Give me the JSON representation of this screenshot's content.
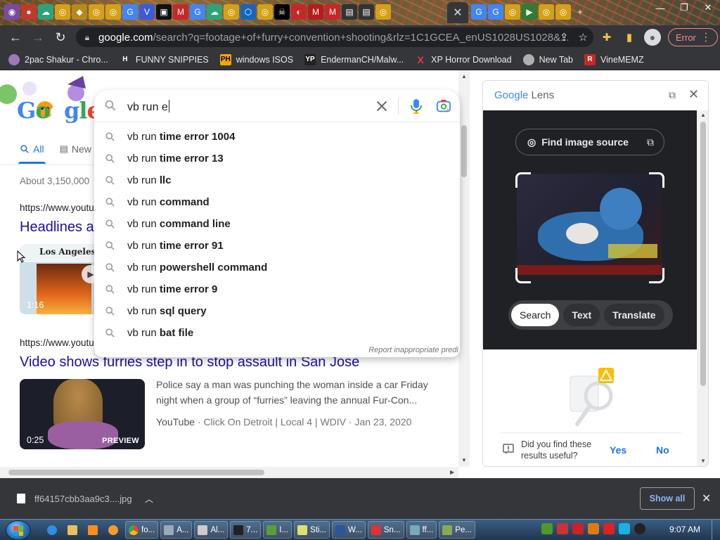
{
  "browser": {
    "active_tab_close": "✕",
    "url_host": "google.com",
    "url_path": "/search?q=footage+of+furry+convention+shooting&rlz=1C1GCEA_enUS1028US1028&...",
    "error_label": "Error"
  },
  "bookmarks": [
    {
      "label": "2pac Shakur - Chro...",
      "icon": "globe-icon"
    },
    {
      "label": "FUNNY SNIPPIES",
      "icon": "H"
    },
    {
      "label": "windows ISOS",
      "icon": "PH"
    },
    {
      "label": "EndermanCH/Malw...",
      "icon": "YP"
    },
    {
      "label": "XP Horror Download",
      "icon": "X"
    },
    {
      "label": "New Tab",
      "icon": "globe-icon"
    },
    {
      "label": "VineMEMZ",
      "icon": "R"
    }
  ],
  "page": {
    "tab_all": "All",
    "tab_news": "New",
    "stats": "About 3,150,000",
    "result1": {
      "cite": "https://www.youtu",
      "title": "Headlines a",
      "duration": "1:16",
      "thumb_title": "Los Angeles Ti"
    },
    "result2": {
      "cite": "https://www.youtu",
      "title": "Video shows furries step in to stop assault in San Jose",
      "duration": "0:25",
      "preview": "PREVIEW",
      "snippet": "Police say a man was punching the woman inside a car Friday night when a group of “furries” leaving the annual Fur-Con...",
      "source": "YouTube",
      "meta": " · Click On Detroit | Local 4 | WDIV · Jan 23, 2020"
    }
  },
  "search": {
    "query": "vb run e",
    "prefix": "vb run ",
    "suggestions": [
      "time error 1004",
      "time error 13",
      "llc",
      "command",
      "command line",
      "time error 91",
      "powershell command",
      "time error 9",
      "sql query",
      "bat file"
    ],
    "report_text": "Report inappropriate predi"
  },
  "lens": {
    "title_google": "Google",
    "title_lens": "Lens",
    "find_source": "Find image source",
    "buttons": [
      "Search",
      "Text",
      "Translate"
    ],
    "feedback_question": "Did you find these results useful?",
    "yes": "Yes",
    "no": "No"
  },
  "downloads": {
    "file": "ff64157cbb3aa9c3....jpg",
    "show_all": "Show all"
  },
  "taskbar": {
    "items": [
      "fo...",
      "A...",
      "Al...",
      "7...",
      "I...",
      "Sti...",
      "W...",
      "Sn...",
      "ff...",
      "Pe..."
    ],
    "clock": "9:07 AM"
  },
  "colors": {
    "link": "#1a0dab",
    "accent": "#1a73e8",
    "chrome_dark": "#35363a"
  }
}
